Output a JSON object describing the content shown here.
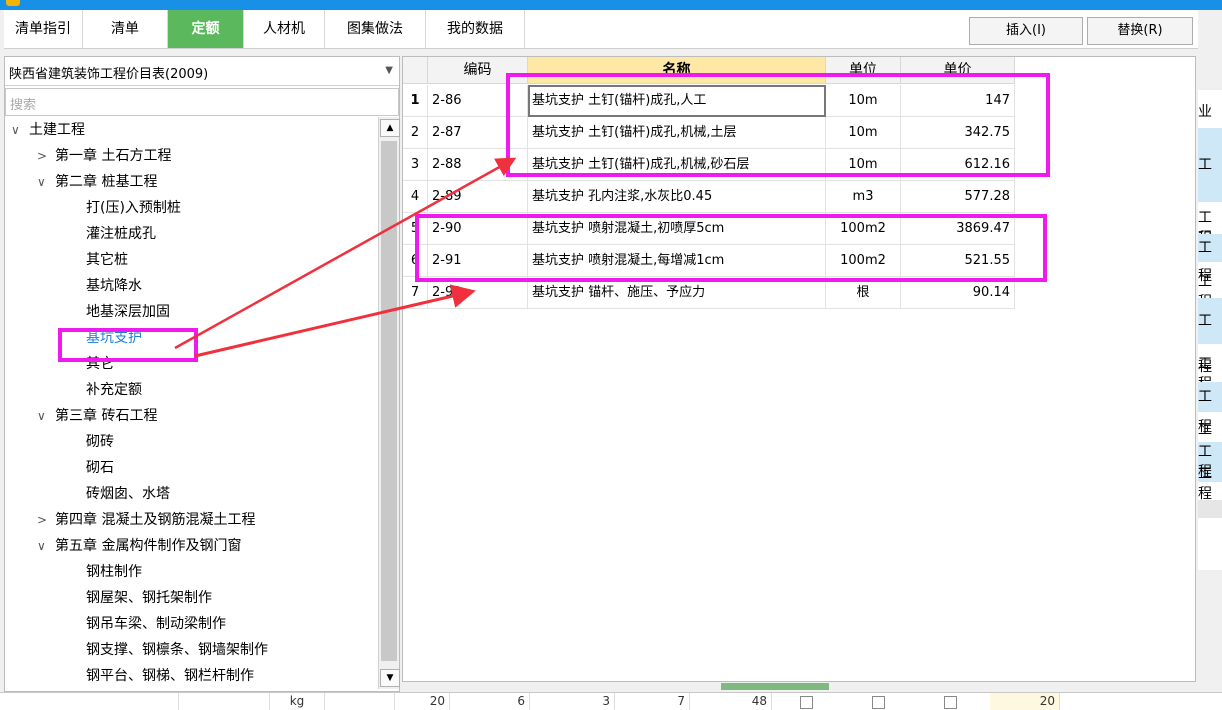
{
  "tabs": [
    "清单指引",
    "清单",
    "定额",
    "人材机",
    "图集做法",
    "我的数据"
  ],
  "buttons": {
    "insert": "插入(I)",
    "replace": "替换(R)"
  },
  "library": {
    "selected": "陕西省建筑装饰工程价目表(2009)"
  },
  "search": {
    "placeholder": "搜索"
  },
  "tree": [
    {
      "label": "土建工程",
      "toggle": "∨"
    },
    {
      "label": "第一章 土石方工程",
      "toggle": ">"
    },
    {
      "label": "第二章 桩基工程",
      "toggle": "∨"
    },
    {
      "label": "打(压)入预制桩",
      "toggle": ""
    },
    {
      "label": "灌注桩成孔",
      "toggle": ""
    },
    {
      "label": "其它桩",
      "toggle": ""
    },
    {
      "label": "基坑降水",
      "toggle": ""
    },
    {
      "label": "地基深层加固",
      "toggle": ""
    },
    {
      "label": "基坑支护",
      "toggle": ""
    },
    {
      "label": "其它",
      "toggle": ""
    },
    {
      "label": "补充定额",
      "toggle": ""
    },
    {
      "label": "第三章 砖石工程",
      "toggle": "∨"
    },
    {
      "label": "砌砖",
      "toggle": ""
    },
    {
      "label": "砌石",
      "toggle": ""
    },
    {
      "label": "砖烟囱、水塔",
      "toggle": ""
    },
    {
      "label": "第四章 混凝土及钢筋混凝土工程",
      "toggle": ">"
    },
    {
      "label": "第五章 金属构件制作及钢门窗",
      "toggle": "∨"
    },
    {
      "label": "钢柱制作",
      "toggle": ""
    },
    {
      "label": "钢屋架、钢托架制作",
      "toggle": ""
    },
    {
      "label": "钢吊车梁、制动梁制作",
      "toggle": ""
    },
    {
      "label": "钢支撑、钢檩条、钢墙架制作",
      "toggle": ""
    },
    {
      "label": "钢平台、钢梯、钢栏杆制作",
      "toggle": ""
    }
  ],
  "grid": {
    "headers": [
      "编码",
      "名称",
      "单位",
      "单价"
    ],
    "rows": [
      {
        "idx": "1",
        "code": "2-86",
        "name": "基坑支护 土钉(锚杆)成孔,人工",
        "unit": "10m",
        "price": "147"
      },
      {
        "idx": "2",
        "code": "2-87",
        "name": "基坑支护 土钉(锚杆)成孔,机械,土层",
        "unit": "10m",
        "price": "342.75"
      },
      {
        "idx": "3",
        "code": "2-88",
        "name": "基坑支护 土钉(锚杆)成孔,机械,砂石层",
        "unit": "10m",
        "price": "612.16"
      },
      {
        "idx": "4",
        "code": "2-89",
        "name": "基坑支护 孔内注浆,水灰比0.45",
        "unit": "m3",
        "price": "577.28"
      },
      {
        "idx": "5",
        "code": "2-90",
        "name": "基坑支护 喷射混凝土,初喷厚5cm",
        "unit": "100m2",
        "price": "3869.47"
      },
      {
        "idx": "6",
        "code": "2-91",
        "name": "基坑支护 喷射混凝土,每增减1cm",
        "unit": "100m2",
        "price": "521.55"
      },
      {
        "idx": "7",
        "code": "2-92",
        "name": "基坑支护 锚杆、施压、予应力",
        "unit": "根",
        "price": "90.14"
      }
    ]
  },
  "right_panel": {
    "header": "业",
    "items": [
      "工程",
      "工程",
      "工程",
      "工程",
      "工程",
      "工程",
      "工程",
      "工程",
      "工程",
      "工程"
    ]
  },
  "bottom": [
    "kg",
    "20",
    "6",
    "3",
    "7",
    "48",
    "20"
  ],
  "colors": {
    "active_tab": "#5cb85c",
    "highlight": "#ee1aee",
    "arrow": "#f0303c",
    "selected_node": "#1e7fd6",
    "titlebar": "#1890e5"
  }
}
